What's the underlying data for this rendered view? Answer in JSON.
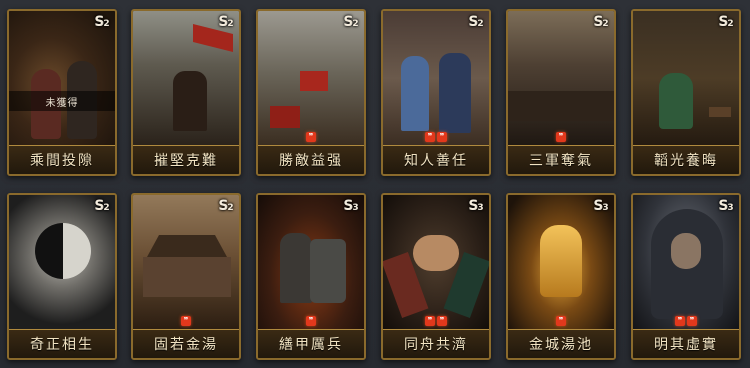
{
  "cards": [
    {
      "name": "乘間投隙",
      "season": "2",
      "marks": 0,
      "unobtained": "未獲得"
    },
    {
      "name": "摧堅克難",
      "season": "2",
      "marks": 0
    },
    {
      "name": "勝敵益强",
      "season": "2",
      "marks": 1
    },
    {
      "name": "知人善任",
      "season": "2",
      "marks": 2
    },
    {
      "name": "三軍奪氣",
      "season": "2",
      "marks": 1
    },
    {
      "name": "韜光養晦",
      "season": "2",
      "marks": 0
    },
    {
      "name": "奇正相生",
      "season": "2",
      "marks": 0
    },
    {
      "name": "固若金湯",
      "season": "2",
      "marks": 1
    },
    {
      "name": "繕甲厲兵",
      "season": "3",
      "marks": 1
    },
    {
      "name": "同舟共濟",
      "season": "3",
      "marks": 2
    },
    {
      "name": "金城湯池",
      "season": "3",
      "marks": 1
    },
    {
      "name": "明其虛實",
      "season": "3",
      "marks": 2
    }
  ],
  "icons": {
    "season": "season-s-icon",
    "mark": "red-rarity-mark-icon"
  },
  "colors": {
    "frame": "#8a6a2c",
    "mark": "#e2381c",
    "label": "#f1e3c2"
  }
}
